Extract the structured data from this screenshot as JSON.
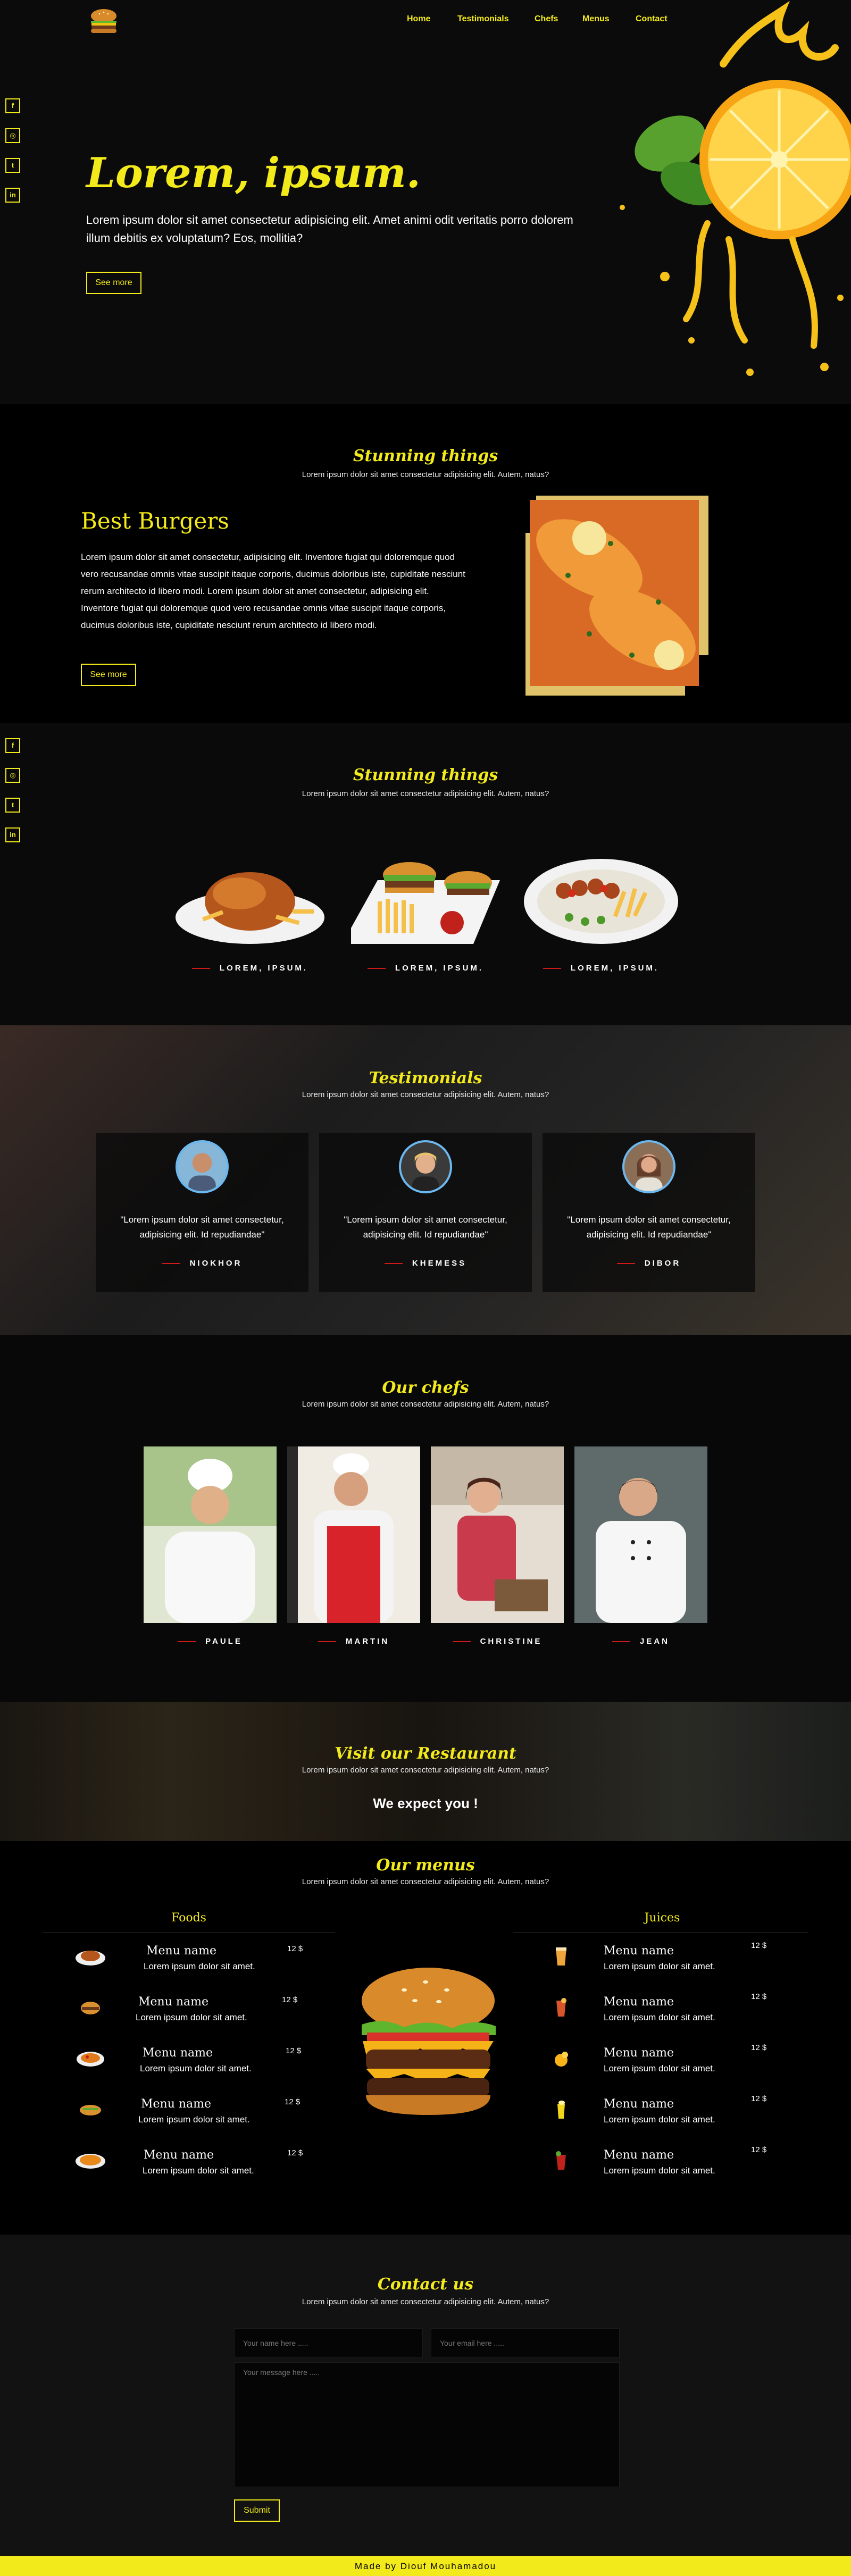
{
  "nav": {
    "links": [
      "Home",
      "Testimonials",
      "Chefs",
      "Menus",
      "Contact"
    ]
  },
  "social": {
    "icons": [
      "facebook-icon",
      "instagram-icon",
      "twitter-icon",
      "linkedin-icon"
    ],
    "glyphs": [
      "f",
      "◎",
      "t",
      "in"
    ]
  },
  "hero": {
    "title": "Lorem, ipsum.",
    "text": "Lorem ipsum dolor sit amet consectetur adipisicing elit. Amet animi odit veritatis porro dolorem illum debitis ex voluptatum? Eos, mollitia?",
    "button": "See more"
  },
  "burgers": {
    "section_title": "Stunning things",
    "section_sub": "Lorem ipsum dolor sit amet consectetur adipisicing elit. Autem, natus?",
    "title": "Best Burgers",
    "text": "Lorem ipsum dolor sit amet consectetur, adipisicing elit. Inventore fugiat qui doloremque quod vero recusandae omnis vitae suscipit itaque corporis, ducimus doloribus iste, cupiditate nesciunt rerum architecto id libero modi. Lorem ipsum dolor sit amet consectetur, adipisicing elit. Inventore fugiat qui doloremque quod vero recusandae omnis vitae suscipit itaque corporis, ducimus doloribus iste, cupiditate nesciunt rerum architecto id libero modi.",
    "button": "See more"
  },
  "things": {
    "title": "Stunning things",
    "sub": "Lorem ipsum dolor sit amet consectetur adipisicing elit. Autem, natus?",
    "labels": [
      "LOREM, IPSUM.",
      "LOREM, IPSUM.",
      "LOREM, IPSUM."
    ]
  },
  "testimonials": {
    "title": "Testimonials",
    "sub": "Lorem ipsum dolor sit amet consectetur adipisicing elit. Autem, natus?",
    "items": [
      {
        "quote": "\"Lorem ipsum dolor sit amet consectetur, adipisicing elit. Id repudiandae\"",
        "name": "NIOKHOR"
      },
      {
        "quote": "\"Lorem ipsum dolor sit amet consectetur, adipisicing elit. Id repudiandae\"",
        "name": "KHEMESS"
      },
      {
        "quote": "\"Lorem ipsum dolor sit amet consectetur, adipisicing elit. Id repudiandae\"",
        "name": "DIBOR"
      }
    ]
  },
  "chefs": {
    "title": "Our chefs",
    "sub": "Lorem ipsum dolor sit amet consectetur adipisicing elit. Autem, natus?",
    "names": [
      "PAULE",
      "MARTIN",
      "CHRISTINE",
      "JEAN"
    ]
  },
  "visit": {
    "title": "Visit our Restaurant",
    "sub": "Lorem ipsum dolor sit amet consectetur adipisicing elit. Autem, natus?",
    "tagline": "We expect you !"
  },
  "menus": {
    "title": "Our menus",
    "sub": "Lorem ipsum dolor sit amet consectetur adipisicing elit. Autem, natus?",
    "foods_heading": "Foods",
    "juices_heading": "Juices",
    "item_name": "Menu name",
    "item_desc": "Lorem ipsum dolor sit amet.",
    "item_price": "12 $"
  },
  "contact": {
    "title": "Contact us",
    "sub": "Lorem ipsum dolor sit amet consectetur adipisicing elit. Autem, natus?",
    "name_placeholder": "Your name here .....",
    "email_placeholder": "Your email here .....",
    "message_placeholder": "Your message here .....",
    "submit": "Submit"
  },
  "footer": {
    "text": "Made by Diouf Mouhamadou"
  },
  "colors": {
    "accent": "#f3ea1b",
    "background": "#050505",
    "divider_red": "#d01919"
  }
}
